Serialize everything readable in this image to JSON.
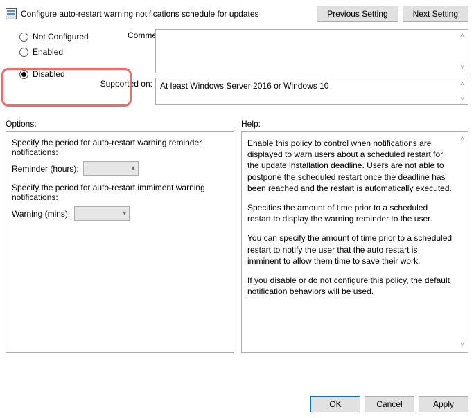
{
  "header": {
    "title": "Configure auto-restart warning notifications schedule for updates",
    "prev_setting_label": "Previous Setting",
    "next_setting_label": "Next Setting"
  },
  "state": {
    "not_configured_label": "Not Configured",
    "enabled_label": "Enabled",
    "disabled_label": "Disabled",
    "selected": "disabled"
  },
  "comment": {
    "label": "Comment:",
    "value": ""
  },
  "supported": {
    "label": "Supported on:",
    "text": "At least Windows Server 2016 or Windows 10"
  },
  "options": {
    "label": "Options:",
    "specify_reminder": "Specify the period for auto-restart warning reminder notifications:",
    "reminder_label": "Reminder (hours):",
    "reminder_value": "",
    "specify_imminent": "Specify the period for auto-restart immiment warning notifications:",
    "warning_label": "Warning (mins):",
    "warning_value": ""
  },
  "help": {
    "label": "Help:",
    "p1": "Enable this policy to control when notifications are displayed to warn users about a scheduled restart for the update installation deadline. Users are not able to postpone the scheduled restart once the deadline has been reached and the restart is automatically executed.",
    "p2": "Specifies the amount of time prior to a scheduled restart to display the warning reminder to the user.",
    "p3": "You can specify the amount of time prior to a scheduled restart to notify the user that the auto restart is imminent to allow them time to save their work.",
    "p4": "If you disable or do not configure this policy, the default notification behaviors will be used."
  },
  "buttons": {
    "ok": "OK",
    "cancel": "Cancel",
    "apply": "Apply"
  }
}
